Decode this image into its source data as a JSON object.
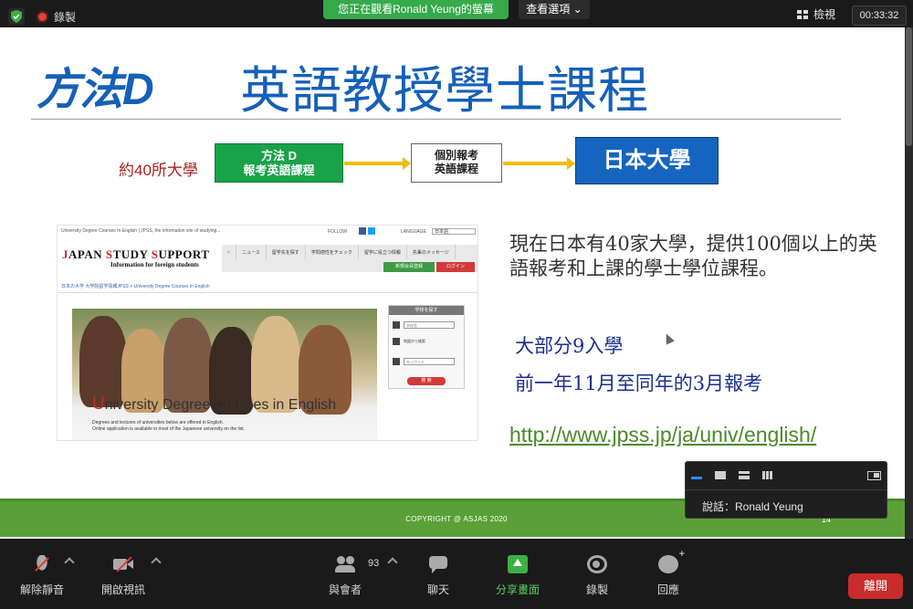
{
  "top_bar": {
    "recording_label": "錄製",
    "viewing_banner": "您正在觀看Ronald Yeung的螢幕",
    "view_options": "查看選項 ⌄",
    "view_button": "檢視",
    "timer": "00:33:32"
  },
  "slide": {
    "logo": "方法D",
    "title": "英語教授學士課程",
    "flow": {
      "count_label": "約40所大學",
      "green_box_line1": "方法 D",
      "green_box_line2": "報考英語課程",
      "white_box_line1": "個別報考",
      "white_box_line2": "英語課程",
      "blue_box": "日本大學"
    },
    "website": {
      "tagline": "University Degree Courses In English | JPSS, the information site of studying...",
      "follow": "FOLLOW",
      "language_label": "LANGUAGE",
      "language_value": "日本語",
      "logo_text": "JAPAN STUDY SUPPORT",
      "logo_sub": "Information for foreign students",
      "nav": [
        "⌂",
        "ニュース",
        "留学先を探す",
        "学問適性をチェック",
        "留学に役立つ情報",
        "先輩のメッセージ"
      ],
      "register": "新規会員登録",
      "login": "ログイン",
      "breadcrumb": "日本の大学 大学院留学情報JPSS > University Degree Courses In English",
      "hero_title_first": "U",
      "hero_title_rest": "niversity Degree Courses in English",
      "hero_desc1": "Degrees and lectures of universities below are offered in English.",
      "hero_desc2": "Online application is available in most of the Japanese university on the list.",
      "search_head": "学校を探す",
      "search_field1": "学校名",
      "search_field2": "地図から検索",
      "search_field3": "キーワード",
      "search_button": "検 索"
    },
    "description": "現在日本有40家大學，提供100個以上的英語報考和上課的學士學位課程。",
    "stat1": "大部分9入學",
    "stat2": "前一年11月至同年的3月報考",
    "url": "http://www.jpss.jp/ja/univ/english/",
    "copyright": "COPYRIGHT @ ASJAS 2020",
    "page_number": "14"
  },
  "speaker": {
    "label": "說話：Ronald Yeung"
  },
  "toolbar": {
    "mute": "解除靜音",
    "video": "開啟視訊",
    "participants": "與會者",
    "participant_count": "93",
    "chat": "聊天",
    "share": "分享畫面",
    "record": "錄製",
    "reactions": "回應",
    "leave": "離開"
  }
}
